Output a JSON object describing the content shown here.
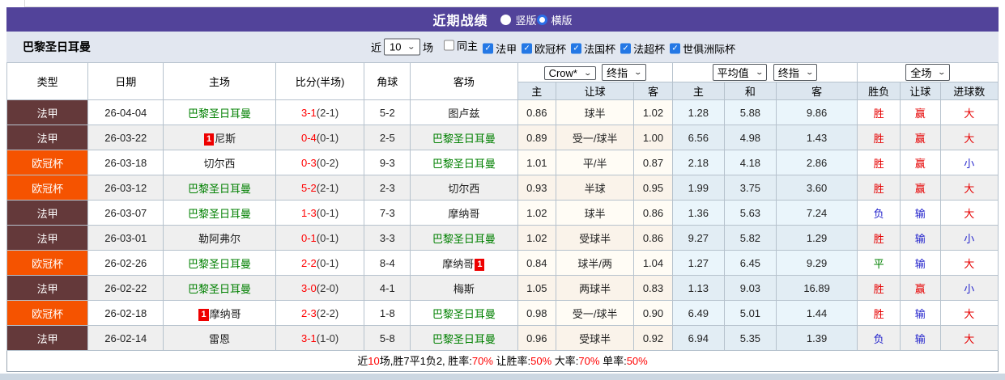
{
  "page": {
    "title_bar": {
      "title": "近期战绩",
      "radios": [
        {
          "label": "竖版",
          "selected": false
        },
        {
          "label": "横版",
          "selected": true
        }
      ]
    },
    "filter": {
      "team": "巴黎圣日耳曼",
      "near_label": "近",
      "match_count": "10",
      "games_label": "场",
      "checkboxes": [
        {
          "label": "同主",
          "checked": false
        },
        {
          "label": "法甲",
          "checked": true
        },
        {
          "label": "欧冠杯",
          "checked": true
        },
        {
          "label": "法国杯",
          "checked": true
        },
        {
          "label": "法超杯",
          "checked": true
        },
        {
          "label": "世俱洲际杯",
          "checked": true
        }
      ]
    },
    "table": {
      "group_selects": {
        "crow_source": "Crow*",
        "crow_period": "终指",
        "avg_source": "平均值",
        "avg_period": "终指",
        "scope": "全场"
      },
      "columns_left": [
        "类型",
        "日期",
        "主场",
        "比分(半场)",
        "角球",
        "客场"
      ],
      "columns_right": [
        "主",
        "让球",
        "客",
        "主",
        "和",
        "客",
        "胜负",
        "让球",
        "进球数"
      ],
      "rows": [
        {
          "type": "法甲",
          "type_style": "fa",
          "date": "26-04-04",
          "home": {
            "name": "巴黎圣日耳曼",
            "green": true,
            "badge": null,
            "badge_pos": null
          },
          "score_ft": "3-1",
          "score_ht": "(2-1)",
          "corners": "5-2",
          "away": {
            "name": "图卢兹",
            "green": false,
            "badge": null,
            "badge_pos": null
          },
          "crow": [
            "0.86",
            "球半",
            "1.02"
          ],
          "avg": [
            "1.28",
            "5.88",
            "9.86"
          ],
          "outcome": {
            "text": "胜",
            "c": "red"
          },
          "handicap": {
            "text": "赢",
            "c": "red"
          },
          "goals": {
            "text": "大",
            "c": "red"
          }
        },
        {
          "type": "法甲",
          "type_style": "fa",
          "date": "26-03-22",
          "home": {
            "name": "尼斯",
            "green": false,
            "badge": "1",
            "badge_pos": "before"
          },
          "score_ft": "0-4",
          "score_ht": "(0-1)",
          "corners": "2-5",
          "away": {
            "name": "巴黎圣日耳曼",
            "green": true,
            "badge": null,
            "badge_pos": null
          },
          "crow": [
            "0.89",
            "受一/球半",
            "1.00"
          ],
          "avg": [
            "6.56",
            "4.98",
            "1.43"
          ],
          "outcome": {
            "text": "胜",
            "c": "red"
          },
          "handicap": {
            "text": "赢",
            "c": "red"
          },
          "goals": {
            "text": "大",
            "c": "red"
          }
        },
        {
          "type": "欧冠杯",
          "type_style": "ucl",
          "date": "26-03-18",
          "home": {
            "name": "切尔西",
            "green": false,
            "badge": null,
            "badge_pos": null
          },
          "score_ft": "0-3",
          "score_ht": "(0-2)",
          "corners": "9-3",
          "away": {
            "name": "巴黎圣日耳曼",
            "green": true,
            "badge": null,
            "badge_pos": null
          },
          "crow": [
            "1.01",
            "平/半",
            "0.87"
          ],
          "avg": [
            "2.18",
            "4.18",
            "2.86"
          ],
          "outcome": {
            "text": "胜",
            "c": "red"
          },
          "handicap": {
            "text": "赢",
            "c": "red"
          },
          "goals": {
            "text": "小",
            "c": "blue"
          }
        },
        {
          "type": "欧冠杯",
          "type_style": "ucl",
          "date": "26-03-12",
          "home": {
            "name": "巴黎圣日耳曼",
            "green": true,
            "badge": null,
            "badge_pos": null
          },
          "score_ft": "5-2",
          "score_ht": "(2-1)",
          "corners": "2-3",
          "away": {
            "name": "切尔西",
            "green": false,
            "badge": null,
            "badge_pos": null
          },
          "crow": [
            "0.93",
            "半球",
            "0.95"
          ],
          "avg": [
            "1.99",
            "3.75",
            "3.60"
          ],
          "outcome": {
            "text": "胜",
            "c": "red"
          },
          "handicap": {
            "text": "赢",
            "c": "red"
          },
          "goals": {
            "text": "大",
            "c": "red"
          }
        },
        {
          "type": "法甲",
          "type_style": "fa",
          "date": "26-03-07",
          "home": {
            "name": "巴黎圣日耳曼",
            "green": true,
            "badge": null,
            "badge_pos": null
          },
          "score_ft": "1-3",
          "score_ht": "(0-1)",
          "corners": "7-3",
          "away": {
            "name": "摩纳哥",
            "green": false,
            "badge": null,
            "badge_pos": null
          },
          "crow": [
            "1.02",
            "球半",
            "0.86"
          ],
          "avg": [
            "1.36",
            "5.63",
            "7.24"
          ],
          "outcome": {
            "text": "负",
            "c": "blue"
          },
          "handicap": {
            "text": "输",
            "c": "blue"
          },
          "goals": {
            "text": "大",
            "c": "red"
          }
        },
        {
          "type": "法甲",
          "type_style": "fa",
          "date": "26-03-01",
          "home": {
            "name": "勒阿弗尔",
            "green": false,
            "badge": null,
            "badge_pos": null
          },
          "score_ft": "0-1",
          "score_ht": "(0-1)",
          "corners": "3-3",
          "away": {
            "name": "巴黎圣日耳曼",
            "green": true,
            "badge": null,
            "badge_pos": null
          },
          "crow": [
            "1.02",
            "受球半",
            "0.86"
          ],
          "avg": [
            "9.27",
            "5.82",
            "1.29"
          ],
          "outcome": {
            "text": "胜",
            "c": "red"
          },
          "handicap": {
            "text": "输",
            "c": "blue"
          },
          "goals": {
            "text": "小",
            "c": "blue"
          }
        },
        {
          "type": "欧冠杯",
          "type_style": "ucl",
          "date": "26-02-26",
          "home": {
            "name": "巴黎圣日耳曼",
            "green": true,
            "badge": null,
            "badge_pos": null
          },
          "score_ft": "2-2",
          "score_ht": "(0-1)",
          "corners": "8-4",
          "away": {
            "name": "摩纳哥",
            "green": false,
            "badge": "1",
            "badge_pos": "after"
          },
          "crow": [
            "0.84",
            "球半/两",
            "1.04"
          ],
          "avg": [
            "1.27",
            "6.45",
            "9.29"
          ],
          "outcome": {
            "text": "平",
            "c": "green"
          },
          "handicap": {
            "text": "输",
            "c": "blue"
          },
          "goals": {
            "text": "大",
            "c": "red"
          }
        },
        {
          "type": "法甲",
          "type_style": "fa",
          "date": "26-02-22",
          "home": {
            "name": "巴黎圣日耳曼",
            "green": true,
            "badge": null,
            "badge_pos": null
          },
          "score_ft": "3-0",
          "score_ht": "(2-0)",
          "corners": "4-1",
          "away": {
            "name": "梅斯",
            "green": false,
            "badge": null,
            "badge_pos": null
          },
          "crow": [
            "1.05",
            "两球半",
            "0.83"
          ],
          "avg": [
            "1.13",
            "9.03",
            "16.89"
          ],
          "outcome": {
            "text": "胜",
            "c": "red"
          },
          "handicap": {
            "text": "赢",
            "c": "red"
          },
          "goals": {
            "text": "小",
            "c": "blue"
          }
        },
        {
          "type": "欧冠杯",
          "type_style": "ucl",
          "date": "26-02-18",
          "home": {
            "name": "摩纳哥",
            "green": false,
            "badge": "1",
            "badge_pos": "before"
          },
          "score_ft": "2-3",
          "score_ht": "(2-2)",
          "corners": "1-8",
          "away": {
            "name": "巴黎圣日耳曼",
            "green": true,
            "badge": null,
            "badge_pos": null
          },
          "crow": [
            "0.98",
            "受一/球半",
            "0.90"
          ],
          "avg": [
            "6.49",
            "5.01",
            "1.44"
          ],
          "outcome": {
            "text": "胜",
            "c": "red"
          },
          "handicap": {
            "text": "输",
            "c": "blue"
          },
          "goals": {
            "text": "大",
            "c": "red"
          }
        },
        {
          "type": "法甲",
          "type_style": "fa",
          "date": "26-02-14",
          "home": {
            "name": "雷恩",
            "green": false,
            "badge": null,
            "badge_pos": null
          },
          "score_ft": "3-1",
          "score_ht": "(1-0)",
          "corners": "5-8",
          "away": {
            "name": "巴黎圣日耳曼",
            "green": true,
            "badge": null,
            "badge_pos": null
          },
          "crow": [
            "0.96",
            "受球半",
            "0.92"
          ],
          "avg": [
            "6.94",
            "5.35",
            "1.39"
          ],
          "outcome": {
            "text": "负",
            "c": "blue"
          },
          "handicap": {
            "text": "输",
            "c": "blue"
          },
          "goals": {
            "text": "大",
            "c": "red"
          }
        }
      ]
    },
    "summary": {
      "segments": [
        {
          "text": "近",
          "c": "black"
        },
        {
          "text": "10",
          "c": "red"
        },
        {
          "text": "场,胜7平1负2, 胜率:",
          "c": "black"
        },
        {
          "text": "70%",
          "c": "red"
        },
        {
          "text": " 让胜率:",
          "c": "black"
        },
        {
          "text": "50%",
          "c": "red"
        },
        {
          "text": " 大率:",
          "c": "black"
        },
        {
          "text": "70%",
          "c": "red"
        },
        {
          "text": " 单率:",
          "c": "black"
        },
        {
          "text": "50%",
          "c": "red"
        }
      ]
    },
    "colors": {
      "accent_purple": "#52439a",
      "league_ligue1_bg": "#64393a",
      "league_ucl_bg": "#f55300",
      "win_red": "#e60000",
      "lose_blue": "#2424cc",
      "draw_green": "#008000",
      "team_green": "#008000",
      "score_red": "#ff0000",
      "crow_odds_bg": "#fffcf5",
      "avg_odds_bg": "#eaf5fb",
      "checkbox_blue": "#2478e5"
    }
  }
}
